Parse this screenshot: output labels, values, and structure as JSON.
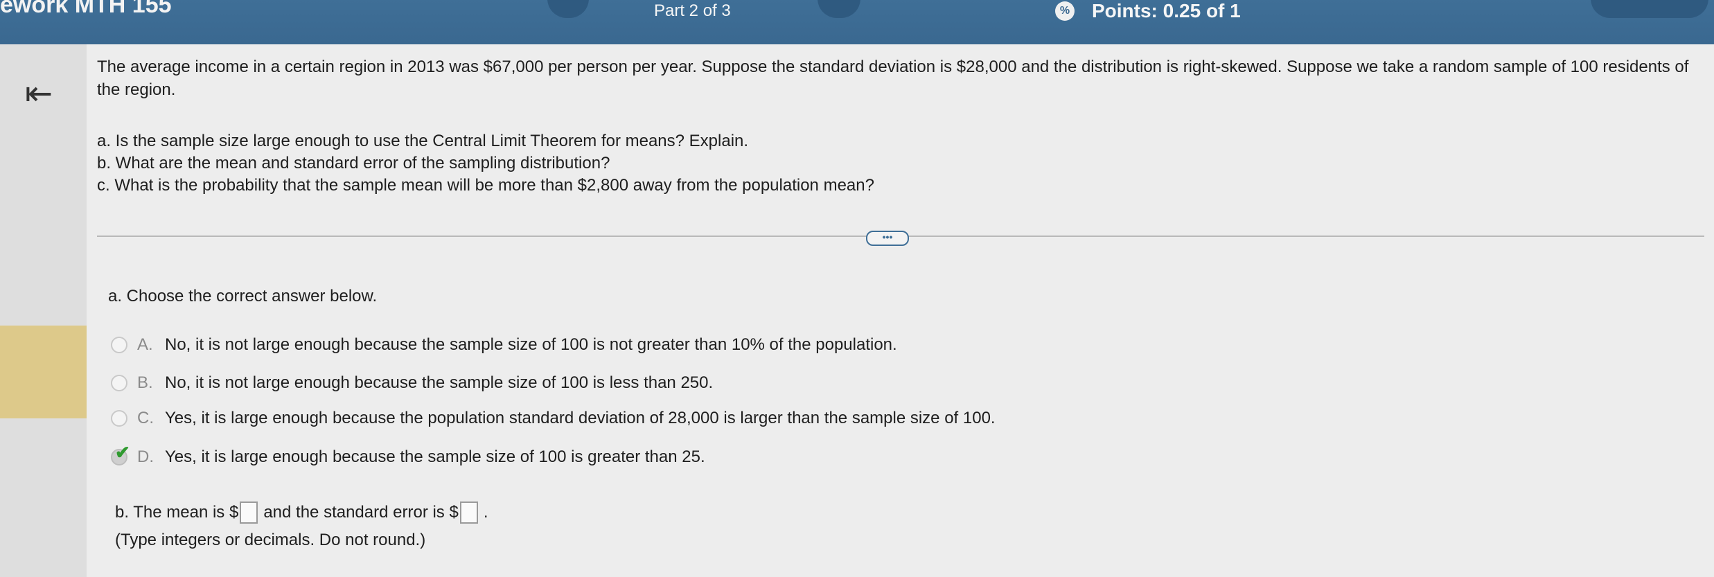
{
  "header": {
    "course": "ework MTH 155",
    "part": "Part 2 of 3",
    "points": "Points: 0.25 of 1",
    "points_icon": "%"
  },
  "nav": {
    "back_icon": "⇤"
  },
  "problem": {
    "text": "The average income in a certain region in 2013 was $67,000 per person per year. Suppose the standard deviation is $28,000 and the distribution is right-skewed. Suppose we take a random sample of 100 residents of the region.",
    "parts": [
      "a. Is the sample size large enough to use the Central Limit Theorem for means? Explain.",
      "b. What are the mean and standard error of the sampling distribution?",
      "c. What is the probability that the sample mean will be more than $2,800 away from the population mean?"
    ]
  },
  "more_button": "•••",
  "question_a": {
    "prompt": "a. Choose the correct answer below.",
    "options": [
      {
        "letter": "A.",
        "text": "No, it is not large enough because the sample size of 100 is not greater than 10% of the population."
      },
      {
        "letter": "B.",
        "text": "No, it is not large enough because the sample size of 100 is less than 250."
      },
      {
        "letter": "C.",
        "text": "Yes, it is large enough because the population standard deviation of 28,000 is larger than the sample size of 100."
      },
      {
        "letter": "D.",
        "text": "Yes, it is large enough because the sample size of 100 is greater than 25."
      }
    ],
    "selected": "D",
    "check_icon": "✔"
  },
  "question_b": {
    "prefix": "b. The mean is $",
    "middle": "and the standard error is $",
    "suffix": ".",
    "mean_value": "",
    "se_value": "",
    "hint": "(Type integers or decimals. Do not round.)"
  },
  "colors": {
    "header_bg": "#3a6890",
    "page_bg": "#ededed",
    "highlight": "#ddc98a",
    "check": "#2f9a2f"
  }
}
